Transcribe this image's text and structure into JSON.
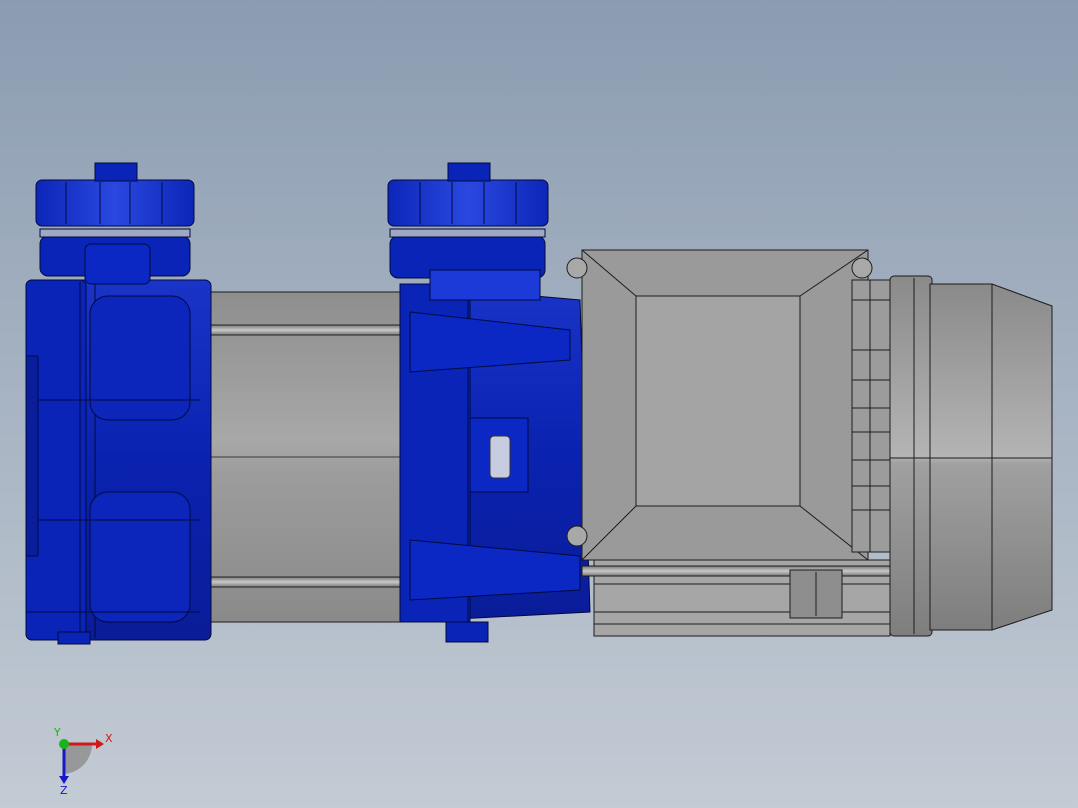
{
  "viewport": {
    "background_top": "#8b9cb1",
    "background_bottom": "#c3cbd4"
  },
  "model": {
    "pump_head_color": "#0a22b4",
    "motor_color": "#9a9a9a",
    "edge_color": "#1c1c1c"
  },
  "triad": {
    "x_label": "X",
    "y_label": "Y",
    "z_label": "Z",
    "x_color": "#d01818",
    "y_color": "#18b418",
    "z_color": "#1818c8"
  }
}
